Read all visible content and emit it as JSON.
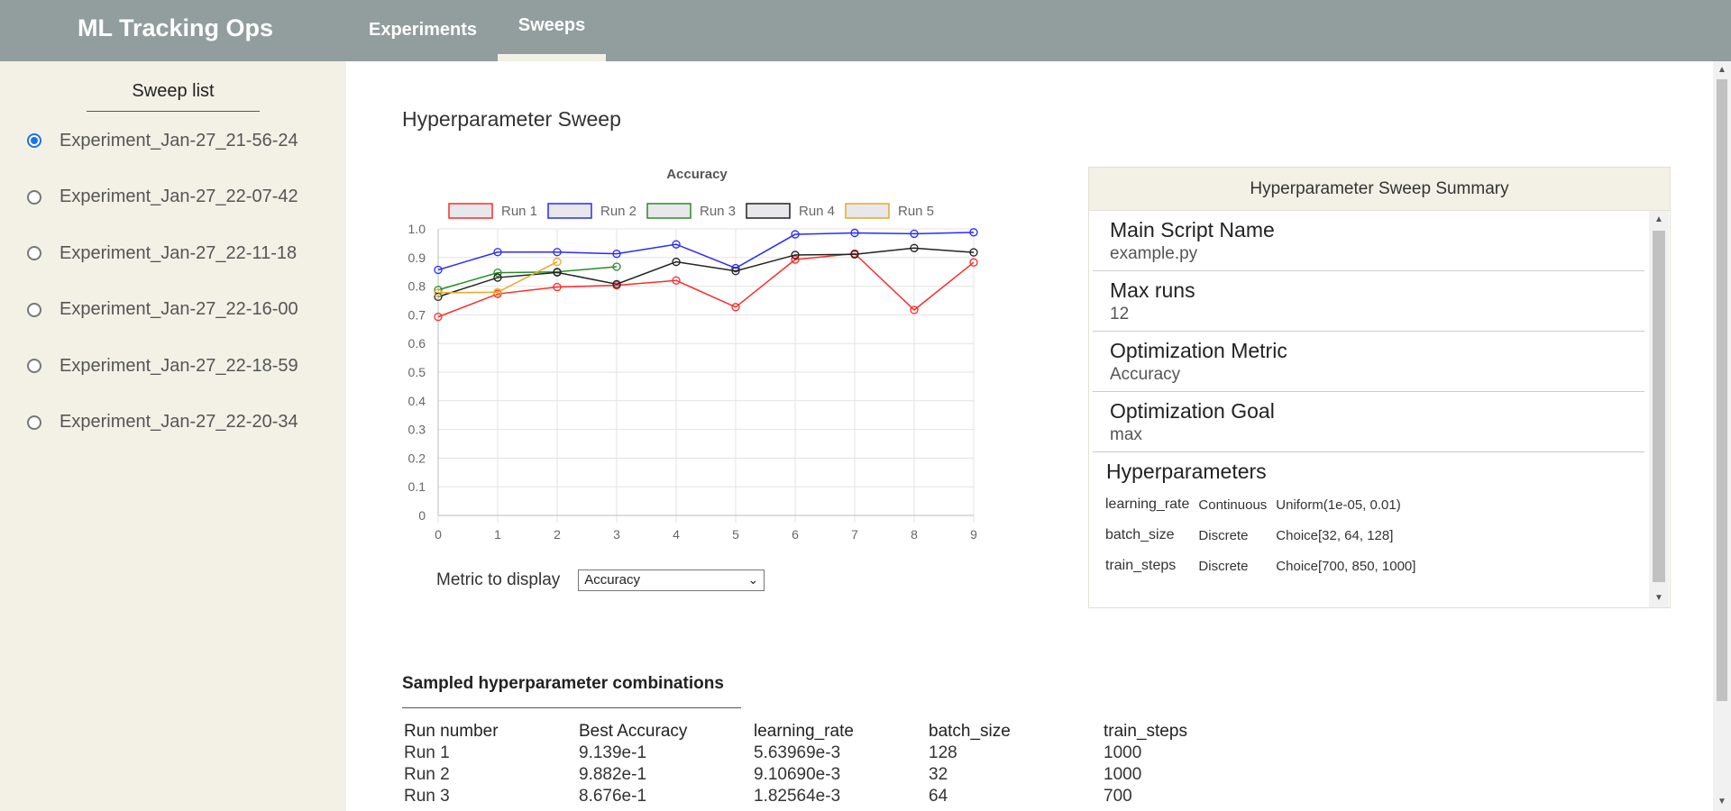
{
  "app": {
    "title": "ML Tracking Ops"
  },
  "nav": {
    "tabs": [
      "Experiments",
      "Sweeps"
    ],
    "active": "Sweeps"
  },
  "sidebar": {
    "title": "Sweep list",
    "items": [
      {
        "label": "Experiment_Jan-27_21-56-24",
        "selected": true
      },
      {
        "label": "Experiment_Jan-27_22-07-42",
        "selected": false
      },
      {
        "label": "Experiment_Jan-27_22-11-18",
        "selected": false
      },
      {
        "label": "Experiment_Jan-27_22-16-00",
        "selected": false
      },
      {
        "label": "Experiment_Jan-27_22-18-59",
        "selected": false
      },
      {
        "label": "Experiment_Jan-27_22-20-34",
        "selected": false
      }
    ]
  },
  "main": {
    "title": "Hyperparameter Sweep",
    "metric_label": "Metric to display",
    "metric_selected": "Accuracy"
  },
  "chart_data": {
    "type": "line",
    "title": "Accuracy",
    "xlabel": "",
    "ylabel": "",
    "x": [
      0,
      1,
      2,
      3,
      4,
      5,
      6,
      7,
      8,
      9
    ],
    "xlim": [
      0,
      9
    ],
    "ylim": [
      0,
      1.0
    ],
    "yticks": [
      "0",
      "0.1",
      "0.2",
      "0.3",
      "0.4",
      "0.5",
      "0.6",
      "0.7",
      "0.8",
      "0.9",
      "1.0"
    ],
    "grid": true,
    "legend": "top",
    "series": [
      {
        "name": "Run 1",
        "color": "#ff2a2a",
        "values": [
          0.693,
          0.773,
          0.797,
          0.803,
          0.82,
          0.727,
          0.893,
          0.914,
          0.717,
          0.883
        ]
      },
      {
        "name": "Run 2",
        "color": "#2a2aff",
        "values": [
          0.857,
          0.919,
          0.919,
          0.913,
          0.946,
          0.863,
          0.981,
          0.986,
          0.983,
          0.988
        ]
      },
      {
        "name": "Run 3",
        "color": "#2a8a2a",
        "values": [
          0.787,
          0.847,
          0.85,
          0.868
        ]
      },
      {
        "name": "Run 4",
        "color": "#222222",
        "values": [
          0.763,
          0.83,
          0.848,
          0.807,
          0.885,
          0.853,
          0.909,
          0.911,
          0.933,
          0.918
        ]
      },
      {
        "name": "Run 5",
        "color": "#e6a82a",
        "values": [
          0.777,
          0.779,
          0.885
        ]
      }
    ]
  },
  "summary": {
    "title": "Hyperparameter Sweep Summary",
    "script_key": "Main Script Name",
    "script_val": "example.py",
    "runs_key": "Max runs",
    "runs_val": "12",
    "metric_key": "Optimization Metric",
    "metric_val": "Accuracy",
    "goal_key": "Optimization Goal",
    "goal_val": "max",
    "hp_key": "Hyperparameters",
    "hyperparameters": [
      {
        "name": "learning_rate",
        "type": "Continuous",
        "dist": "Uniform(1e-05, 0.01)"
      },
      {
        "name": "batch_size",
        "type": "Discrete",
        "dist": "Choice[32, 64, 128]"
      },
      {
        "name": "train_steps",
        "type": "Discrete",
        "dist": "Choice[700, 850, 1000]"
      }
    ]
  },
  "sampled": {
    "title": "Sampled hyperparameter combinations",
    "headers": [
      "Run number",
      "Best Accuracy",
      "learning_rate",
      "batch_size",
      "train_steps"
    ],
    "rows": [
      [
        "Run 1",
        "9.139e-1",
        "5.63969e-3",
        "128",
        "1000"
      ],
      [
        "Run 2",
        "9.882e-1",
        "9.10690e-3",
        "32",
        "1000"
      ],
      [
        "Run 3",
        "8.676e-1",
        "1.82564e-3",
        "64",
        "700"
      ]
    ]
  }
}
